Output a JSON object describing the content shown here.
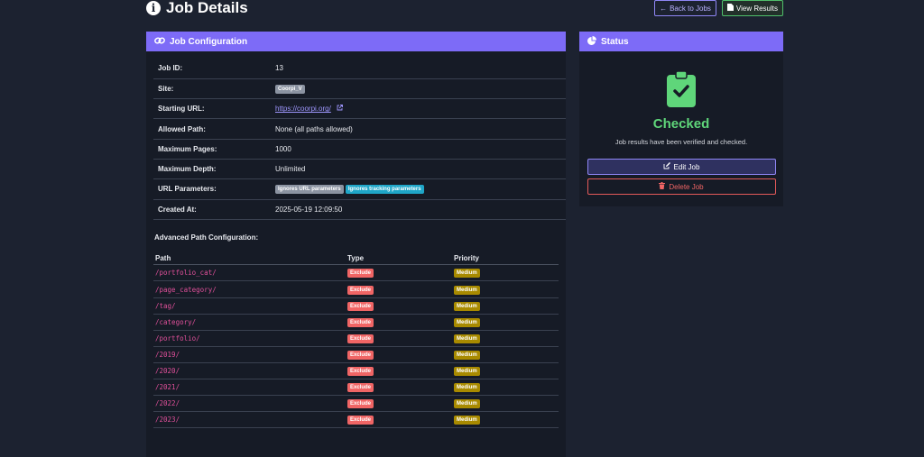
{
  "page": {
    "title": "Job Details"
  },
  "actions": {
    "back_label": "Back to Jobs",
    "results_label": "View Results"
  },
  "config": {
    "header": "Job Configuration",
    "rows": {
      "job_id": {
        "label": "Job ID:",
        "value": "13"
      },
      "site": {
        "label": "Site:",
        "value": "Coorpi_V"
      },
      "starting_url": {
        "label": "Starting URL:",
        "value": "https://coorpi.org/"
      },
      "allowed_path": {
        "label": "Allowed Path:",
        "value": "None (all paths allowed)"
      },
      "max_pages": {
        "label": "Maximum Pages:",
        "value": "1000"
      },
      "max_depth": {
        "label": "Maximum Depth:",
        "value": "Unlimited"
      },
      "url_params": {
        "label": "URL Parameters:",
        "badge1": "Ignores URL parameters",
        "badge2": "Ignores tracking parameters"
      },
      "created_at": {
        "label": "Created At:",
        "value": "2025-05-19 12:09:50"
      }
    },
    "advanced_title": "Advanced Path Configuration:",
    "paths_columns": [
      "Path",
      "Type",
      "Priority"
    ],
    "paths": [
      {
        "path": "/portfolio_cat/",
        "type": "Exclude",
        "priority": "Medium"
      },
      {
        "path": "/page_category/",
        "type": "Exclude",
        "priority": "Medium"
      },
      {
        "path": "/tag/",
        "type": "Exclude",
        "priority": "Medium"
      },
      {
        "path": "/category/",
        "type": "Exclude",
        "priority": "Medium"
      },
      {
        "path": "/portfolio/",
        "type": "Exclude",
        "priority": "Medium"
      },
      {
        "path": "/2019/",
        "type": "Exclude",
        "priority": "Medium"
      },
      {
        "path": "/2020/",
        "type": "Exclude",
        "priority": "Medium"
      },
      {
        "path": "/2021/",
        "type": "Exclude",
        "priority": "Medium"
      },
      {
        "path": "/2022/",
        "type": "Exclude",
        "priority": "Medium"
      },
      {
        "path": "/2023/",
        "type": "Exclude",
        "priority": "Medium"
      }
    ]
  },
  "status": {
    "header": "Status",
    "icon": "clipboard-check-icon",
    "value": "Checked",
    "description": "Job results have been verified and checked.",
    "edit_label": "Edit Job",
    "delete_label": "Delete Job"
  },
  "colors": {
    "background": "#1c2230",
    "accent": "#7d6bf7",
    "success": "#5fd67a",
    "danger": "#f06565",
    "warning": "#a88a00",
    "link": "#9f97ff"
  }
}
